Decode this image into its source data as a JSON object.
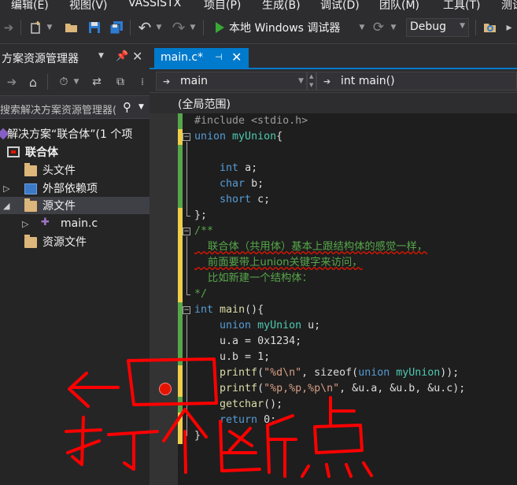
{
  "menu": {
    "items": [
      "编辑(E)",
      "视图(V)",
      "VASSISTX",
      "项目(P)",
      "生成(B)",
      "调试(D)",
      "团队(M)",
      "工具(T)",
      "测试"
    ]
  },
  "toolbar": {
    "run_label": "本地 Windows 调试器",
    "config_value": "Debug"
  },
  "solution_explorer": {
    "title": "方案资源管理器",
    "search_placeholder": "搜索解决方案资源管理器(",
    "items": [
      {
        "label": "解决方案“联合体”(1 个项",
        "icon": "solution-icon"
      },
      {
        "label": "联合体",
        "icon": "project-icon"
      },
      {
        "label": "头文件",
        "icon": "folder-icon"
      },
      {
        "label": "外部依赖项",
        "icon": "external-deps-icon"
      },
      {
        "label": "源文件",
        "icon": "folder-icon"
      },
      {
        "label": "main.c",
        "icon": "c-file-icon"
      },
      {
        "label": "资源文件",
        "icon": "folder-icon"
      }
    ]
  },
  "editor": {
    "tab_label": "main.c*",
    "nav_left": "main",
    "nav_right": "int main()",
    "scope": "(全局范围)",
    "code": {
      "l1": "#include <stdio.h>",
      "l2_kw": "union",
      "l2_id": "myUnion",
      "l2_rest": "{",
      "l4_kw": "int",
      "l4_rest": " a;",
      "l5_kw": "char",
      "l5_rest": " b;",
      "l6_kw": "short",
      "l6_rest": " c;",
      "l7": "};",
      "l8": "/**",
      "l9": "    联合体（共用体）基本上跟结构体的感觉一样，",
      "l10": "    前面要带上union关键字来访问，",
      "l11": "    比如新建一个结构体：",
      "l12": "*/",
      "l13_kw": "int",
      "l13_fn": "main",
      "l13_rest": "(){",
      "l14_kw": "union",
      "l14_id": "myUnion",
      "l14_rest": " u;",
      "l15": "u.a = 0x1234;",
      "l16": "u.b = 1;",
      "l17_fn": "printf",
      "l17_p1": "(",
      "l17_str": "\"%d\\n\"",
      "l17_p2": ", sizeof(",
      "l17_kw": "union",
      "l17_id": "myUnion",
      "l17_p3": "));",
      "l18_fn": "printf",
      "l18_p1": "(",
      "l18_str": "\"%p,%p,%p\\n\"",
      "l18_p2": ", &u.a, &u.b, &u.c);",
      "l19_fn": "getchar",
      "l19_rest": "();",
      "l20_kw": "return",
      "l20_rest": " 0;",
      "l21": "}"
    }
  },
  "annotation": {
    "handwritten_text": "打个断点",
    "ink_color": "#ff0000"
  }
}
